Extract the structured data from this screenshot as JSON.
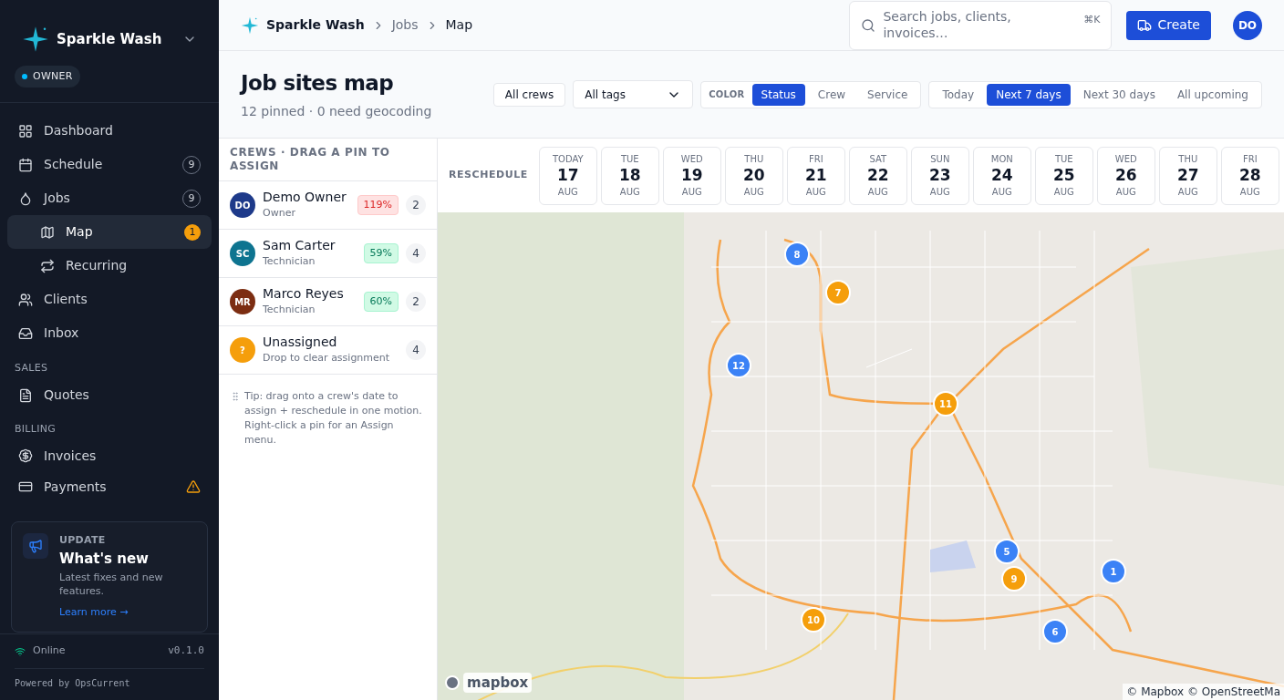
{
  "sidebar": {
    "brand": "Sparkle Wash",
    "role": "OWNER",
    "items": [
      {
        "label": "Dashboard",
        "selected": false,
        "sub": false
      },
      {
        "label": "Schedule",
        "badge": "9",
        "kind": "count",
        "selected": false,
        "sub": false
      },
      {
        "label": "Jobs",
        "badge": "9",
        "kind": "count",
        "selected": false,
        "sub": false
      },
      {
        "label": "Map",
        "badge": "1",
        "kind": "alert",
        "selected": true,
        "sub": true
      },
      {
        "label": "Recurring",
        "selected": false,
        "sub": true
      },
      {
        "label": "Clients",
        "selected": false,
        "sub": false
      },
      {
        "label": "Inbox",
        "selected": false,
        "sub": false
      }
    ],
    "sections": [
      {
        "title": "SALES",
        "items": [
          {
            "label": "Quotes",
            "warning": false
          }
        ]
      },
      {
        "title": "BILLING",
        "items": [
          {
            "label": "Invoices",
            "warning": false
          },
          {
            "label": "Payments",
            "warning": true
          }
        ]
      }
    ],
    "update": {
      "eyebrow": "UPDATE",
      "title": "What's new",
      "text": "Latest fixes and new features.",
      "link": "Learn more →"
    },
    "status": "Online",
    "version": "v0.1.0",
    "powered": "Powered by OpsCurrent"
  },
  "breadcrumbs": [
    "Sparkle Wash",
    "Jobs",
    "Map"
  ],
  "search": {
    "placeholder": "Search jobs, clients, invoices…",
    "shortcut": "⌘K"
  },
  "create_button": "Create",
  "user_initials": "DO",
  "page": {
    "title": "Job sites map",
    "subtitle": "12 pinned · 0 need geocoding"
  },
  "filters": {
    "crews": "All crews",
    "tags": "All tags",
    "color_label": "COLOR",
    "color_options": [
      {
        "label": "Status",
        "selected": true
      },
      {
        "label": "Crew",
        "selected": false
      },
      {
        "label": "Service",
        "selected": false
      }
    ],
    "ranges": [
      {
        "label": "Today",
        "selected": false
      },
      {
        "label": "Next 7 days",
        "selected": true
      },
      {
        "label": "Next 30 days",
        "selected": false
      },
      {
        "label": "All upcoming",
        "selected": false
      }
    ]
  },
  "crews_panel": {
    "title": "CREWS · DRAG A PIN TO ASSIGN",
    "crews": [
      {
        "initials": "DO",
        "name": "Demo Owner",
        "role": "Owner",
        "load": "119%",
        "over": true,
        "count": "2",
        "color": "#1e3a8a"
      },
      {
        "initials": "SC",
        "name": "Sam Carter",
        "role": "Technician",
        "load": "59%",
        "over": false,
        "count": "4",
        "color": "#0e7490"
      },
      {
        "initials": "MR",
        "name": "Marco Reyes",
        "role": "Technician",
        "load": "60%",
        "over": false,
        "count": "2",
        "color": "#7c2d12"
      },
      {
        "initials": "?",
        "name": "Unassigned",
        "role": "Drop to clear assignment",
        "count": "4",
        "color": "#f59e0b"
      }
    ],
    "tip": "Tip: drag onto a crew's date to assign + reschedule in one motion. Right-click a pin for an Assign menu."
  },
  "reschedule": {
    "label": "RESCHEDULE",
    "days": [
      {
        "dow": "TODAY",
        "day": "17",
        "mon": "AUG"
      },
      {
        "dow": "TUE",
        "day": "18",
        "mon": "AUG"
      },
      {
        "dow": "WED",
        "day": "19",
        "mon": "AUG"
      },
      {
        "dow": "THU",
        "day": "20",
        "mon": "AUG"
      },
      {
        "dow": "FRI",
        "day": "21",
        "mon": "AUG"
      },
      {
        "dow": "SAT",
        "day": "22",
        "mon": "AUG"
      },
      {
        "dow": "SUN",
        "day": "23",
        "mon": "AUG"
      },
      {
        "dow": "MON",
        "day": "24",
        "mon": "AUG"
      },
      {
        "dow": "TUE",
        "day": "25",
        "mon": "AUG"
      },
      {
        "dow": "WED",
        "day": "26",
        "mon": "AUG"
      },
      {
        "dow": "THU",
        "day": "27",
        "mon": "AUG"
      },
      {
        "dow": "FRI",
        "day": "28",
        "mon": "AUG"
      }
    ]
  },
  "map": {
    "pins": [
      {
        "label": "8",
        "color": "#3b82f6"
      },
      {
        "label": "7",
        "color": "#f59e0b"
      },
      {
        "label": "12",
        "color": "#3b82f6"
      },
      {
        "label": "11",
        "color": "#f59e0b"
      },
      {
        "label": "5",
        "color": "#3b82f6"
      },
      {
        "label": "9",
        "color": "#f59e0b"
      },
      {
        "label": "1",
        "color": "#3b82f6"
      },
      {
        "label": "10",
        "color": "#f59e0b"
      },
      {
        "label": "6",
        "color": "#3b82f6"
      }
    ],
    "logo": "mapbox",
    "attribution": "© Mapbox © OpenStreetMa"
  }
}
